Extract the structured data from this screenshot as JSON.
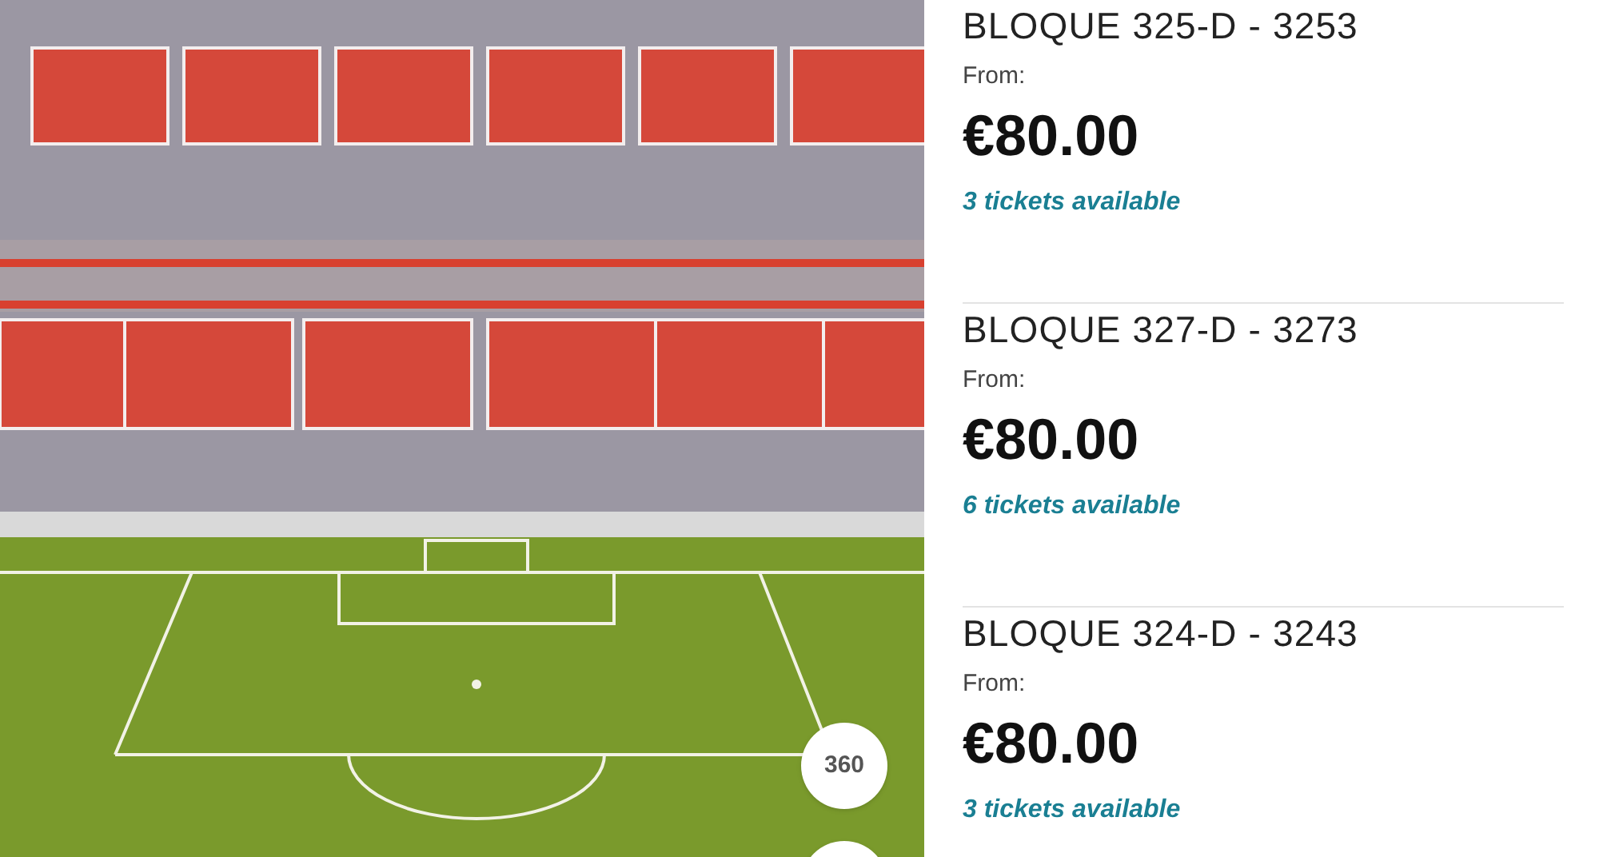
{
  "seat_view": {
    "view_button": {
      "label": "360"
    }
  },
  "listings": [
    {
      "title": "BLOQUE 325-D - 3253",
      "from_label": "From:",
      "price": "€80.00",
      "availability": "3 tickets available"
    },
    {
      "title": "BLOQUE 327-D - 3273",
      "from_label": "From:",
      "price": "€80.00",
      "availability": "6 tickets available"
    },
    {
      "title": "BLOQUE 324-D - 3243",
      "from_label": "From:",
      "price": "€80.00",
      "availability": "3 tickets available"
    }
  ]
}
